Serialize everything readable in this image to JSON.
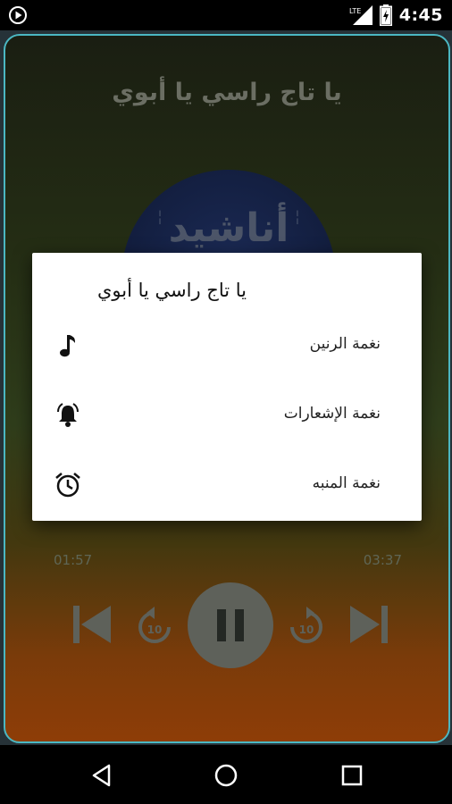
{
  "status_bar": {
    "network_label": "LTE",
    "time": "4:45",
    "icons": [
      "play-circle-icon",
      "lte-signal-icon",
      "battery-charging-icon"
    ]
  },
  "player": {
    "title": "يا تاج راسي يا أبوي",
    "logo_text": "أناشيد",
    "elapsed": "01:57",
    "duration": "03:37",
    "rewind_label": "10",
    "forward_label": "10",
    "controls": [
      "skip-previous-icon",
      "replay-10-icon",
      "pause-icon",
      "forward-10-icon",
      "skip-next-icon"
    ]
  },
  "dialog": {
    "title": "يا تاج راسي يا أبوي",
    "items": [
      {
        "label": "نغمة الرنين",
        "icon": "music-note-icon"
      },
      {
        "label": "نغمة الإشعارات",
        "icon": "bell-ring-icon"
      },
      {
        "label": "نغمة المنبه",
        "icon": "alarm-clock-icon"
      }
    ]
  },
  "nav_bar": {
    "icons": [
      "back-icon",
      "home-icon",
      "recents-icon"
    ]
  },
  "colors": {
    "accent_border": "#4bb7c2",
    "dialog_bg": "#ffffff",
    "controls_gray": "#5e615a"
  }
}
